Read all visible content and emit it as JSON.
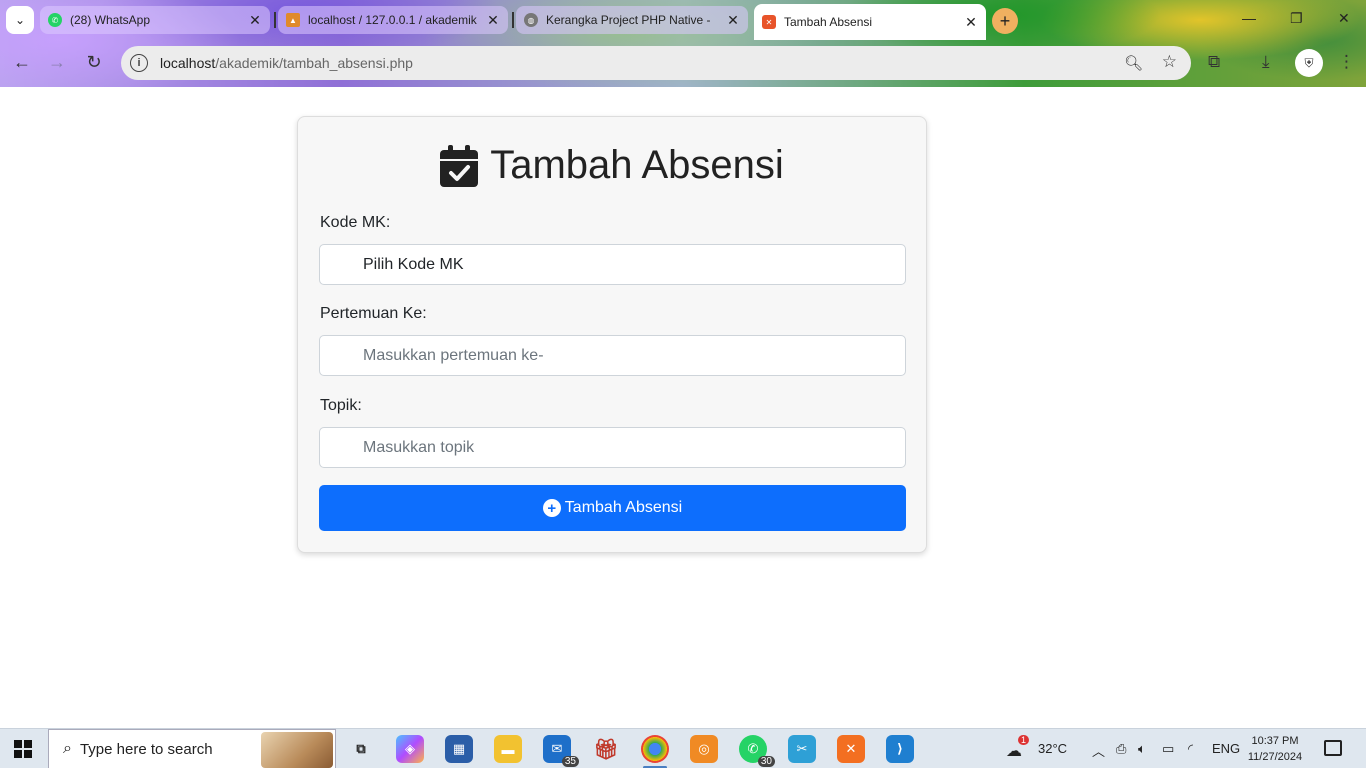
{
  "browser": {
    "tabs": [
      {
        "title": "(28) WhatsApp",
        "favicon_color": "#25d366"
      },
      {
        "title": "localhost / 127.0.0.1 / akademik",
        "favicon_color": "#e08a2b"
      },
      {
        "title": "Kerangka Project PHP Native - ",
        "favicon_color": "#777777"
      },
      {
        "title": "Tambah Absensi",
        "favicon_color": "#e8542a",
        "active": true
      }
    ],
    "url_host": "localhost",
    "url_path": "/akademik/tambah_absensi.php"
  },
  "page": {
    "title": "Tambah Absensi",
    "fields": [
      {
        "label": "Kode MK:",
        "value": "Pilih Kode MK",
        "placeholder": ""
      },
      {
        "label": "Pertemuan Ke:",
        "value": "",
        "placeholder": "Masukkan pertemuan ke-"
      },
      {
        "label": "Topik:",
        "value": "",
        "placeholder": "Masukkan topik"
      }
    ],
    "submit_label": "Tambah Absensi",
    "accent": "#0d6efd"
  },
  "taskbar": {
    "search_placeholder": "Type here to search",
    "mail_badge": "35",
    "whatsapp_badge": "30",
    "weather_badge": "1",
    "temperature": "32°C",
    "language": "ENG",
    "time": "10:37 PM",
    "date": "11/27/2024"
  }
}
